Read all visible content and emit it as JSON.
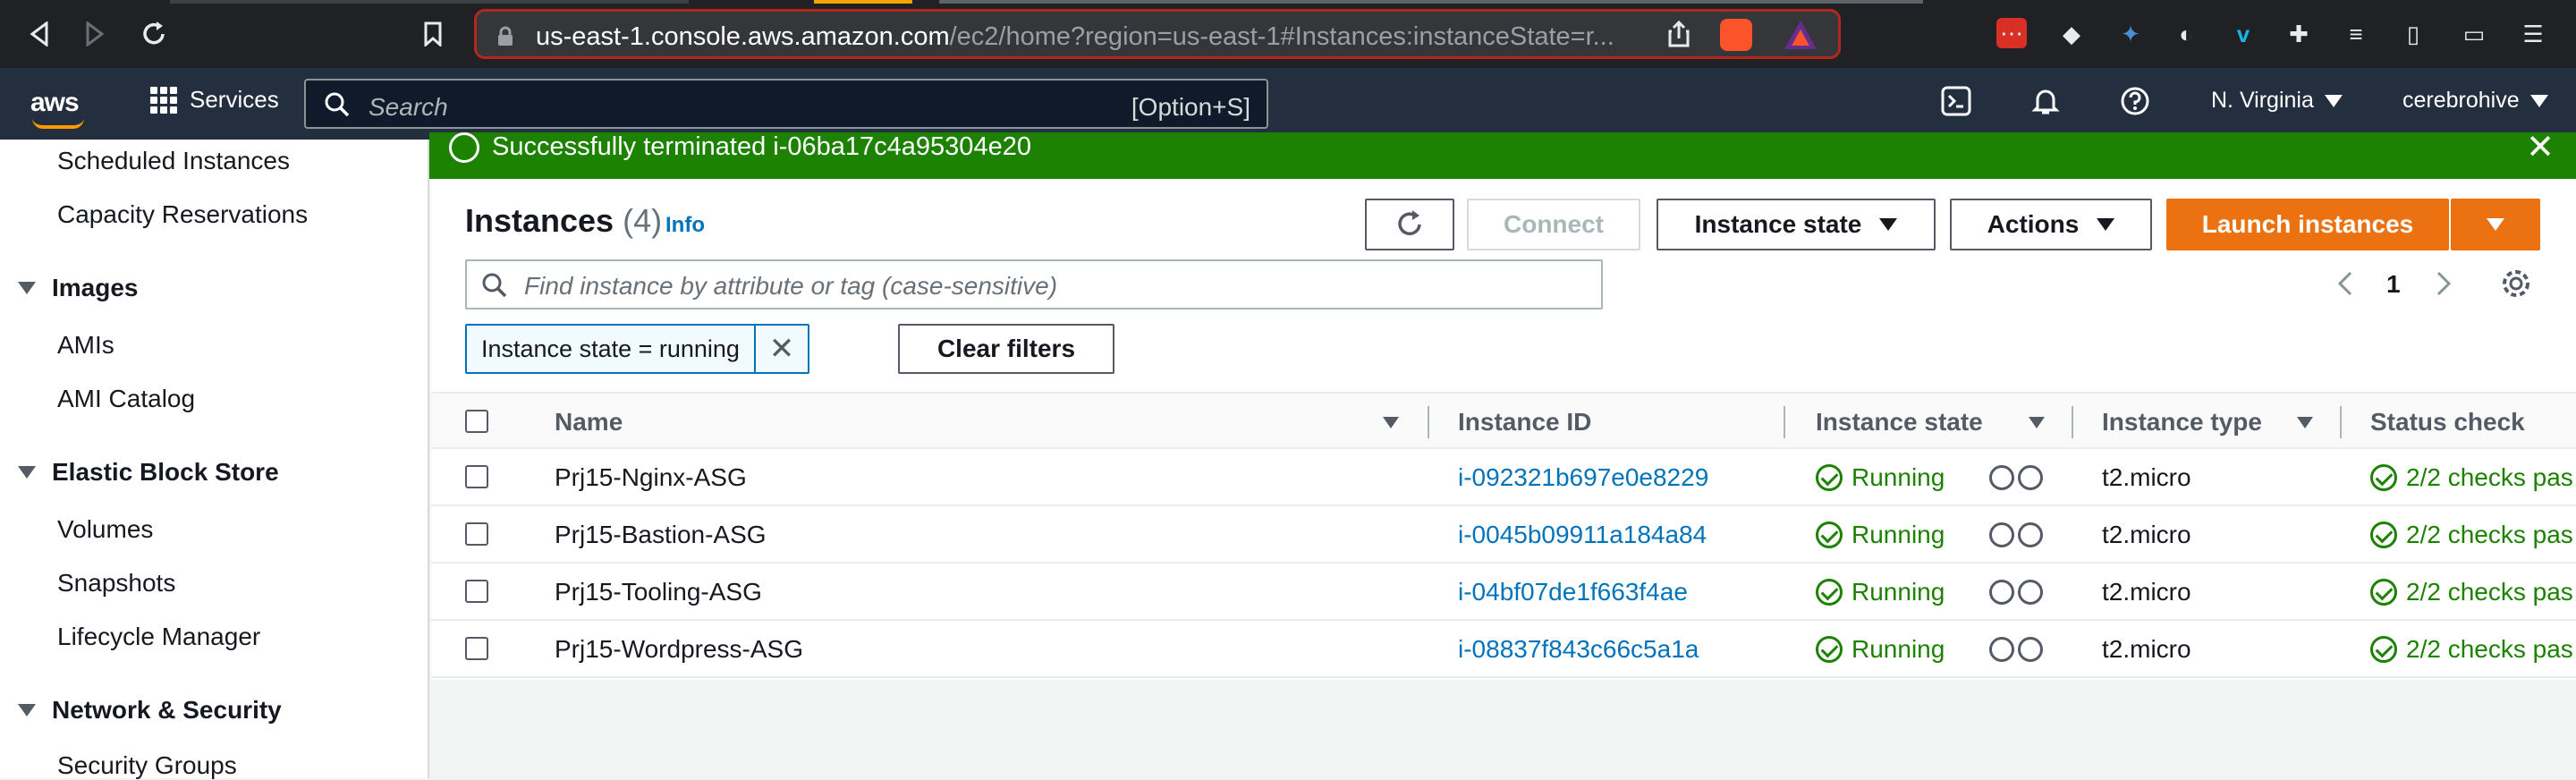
{
  "browser": {
    "url_host": "us-east-1.console.aws.amazon.com",
    "url_path": "/ec2/home?region=us-east-1#Instances:instanceState=r..."
  },
  "aws_nav": {
    "logo": "aws",
    "services_label": "Services",
    "search_placeholder": "Search",
    "search_shortcut": "[Option+S]",
    "region": "N. Virginia",
    "account": "cerebrohive"
  },
  "sidebar": {
    "items_top": [
      "Scheduled Instances",
      "Capacity Reservations"
    ],
    "images_head": "Images",
    "images_items": [
      "AMIs",
      "AMI Catalog"
    ],
    "ebs_head": "Elastic Block Store",
    "ebs_items": [
      "Volumes",
      "Snapshots",
      "Lifecycle Manager"
    ],
    "network_head": "Network & Security",
    "network_items": [
      "Security Groups"
    ]
  },
  "flash": {
    "message": "Successfully terminated i-06ba17c4a95304e20"
  },
  "instances": {
    "title": "Instances",
    "count": "(4)",
    "info_link": "Info",
    "connect_label": "Connect",
    "instance_state_label": "Instance state",
    "actions_label": "Actions",
    "launch_label": "Launch instances",
    "filter_placeholder": "Find instance by attribute or tag (case-sensitive)",
    "page": "1",
    "token_label": "Instance state = running",
    "clear_filters_label": "Clear filters",
    "columns": {
      "name": "Name",
      "instance_id": "Instance ID",
      "state": "Instance state",
      "type": "Instance type",
      "status": "Status check"
    },
    "rows": [
      {
        "name": "Prj15-Nginx-ASG",
        "id": "i-092321b697e0e8229",
        "state": "Running",
        "type": "t2.micro",
        "status": "2/2 checks pas"
      },
      {
        "name": "Prj15-Bastion-ASG",
        "id": "i-0045b09911a184a84",
        "state": "Running",
        "type": "t2.micro",
        "status": "2/2 checks pas"
      },
      {
        "name": "Prj15-Tooling-ASG",
        "id": "i-04bf07de1f663f4ae",
        "state": "Running",
        "type": "t2.micro",
        "status": "2/2 checks pas"
      },
      {
        "name": "Prj15-Wordpress-ASG",
        "id": "i-08837f843c66c5a1a",
        "state": "Running",
        "type": "t2.micro",
        "status": "2/2 checks pas"
      }
    ]
  },
  "colors": {
    "success": "#1d8102",
    "link": "#0073bb",
    "primary": "#ec7211",
    "nav_bg": "#232f3e"
  }
}
